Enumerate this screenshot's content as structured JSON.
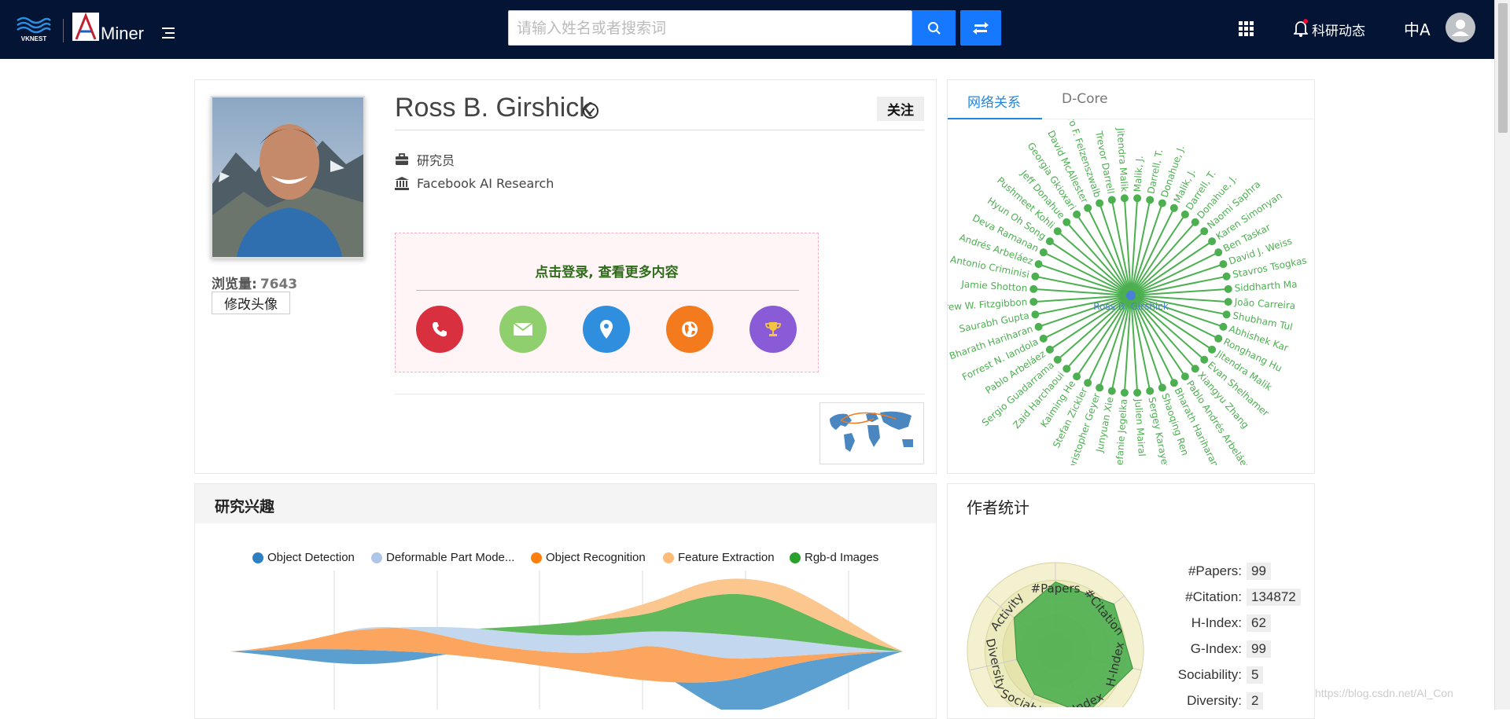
{
  "header": {
    "logo_left": "VKNEST",
    "logo_right": "Miner",
    "search_placeholder": "请输入姓名或者搜索词",
    "news": "科研动态",
    "lang": "中A"
  },
  "profile": {
    "name": "Ross B. Girshick",
    "follow": "关注",
    "position": "研究员",
    "affiliation": "Facebook AI Research",
    "views_label": "浏览量:",
    "views": "7643",
    "edit_avatar": "修改头像",
    "login_prompt": "点击登录, 查看更多内容",
    "contact_icons": [
      "phone-icon",
      "mail-icon",
      "location-icon",
      "homepage-icon",
      "trophy-icon"
    ],
    "contact_colors": [
      "#d9303f",
      "#8fcf6e",
      "#2f8fde",
      "#f37a1d",
      "#8a5bd6"
    ]
  },
  "network": {
    "tabs": [
      "网络关系",
      "D-Core"
    ],
    "center": "Ross B. Girshick",
    "nodes": [
      "Malik, J.",
      "Darrell, T.",
      "Donahue, J.",
      "Malik, J.",
      "Darrell, T.",
      "Donahue, J.",
      "Naomi Saphra",
      "Karen Simonyan",
      "Ben Taskar",
      "David J. Weiss",
      "Stavros Tsogkas",
      "Siddharth Ma",
      "João Carreira",
      "Shubham Tul",
      "Abhishek Kar",
      "Ronghang Hu",
      "Jitendra Malik",
      "Evan Shelhamer",
      "Xiangyu Zhang",
      "Pablo Andrés Arbeláez",
      "Bharath Hariharan",
      "Shaoqing Ren",
      "Sergey Karayev",
      "Julien Mairal",
      "Stefanie Jegelka",
      "Junyuan Xie",
      "Christopher Geyer",
      "Stefan Zickler",
      "Kaiming He",
      "Zaid Harchaoui",
      "Sergio Guadarrama",
      "Pablo Arbeláez",
      "Forrest N. Iandola",
      "Bharath Hariharan",
      "Saurabh Gupta",
      "Andrew W. Fitzgibbon",
      "Jamie Shotton",
      "Antonio Criminisi",
      "Andrés Arbeláez",
      "Deva Ramanan",
      "Hyun Oh Song",
      "Pushmeet Kohli",
      "Jeff Donahue",
      "Georgia Gkioxari",
      "David McAllester",
      "Pedro F. Felzenszwalb",
      "Trevor Darrell",
      "Jitendra Malik"
    ],
    "color": "#4caf50",
    "center_color": "#4a7fd8"
  },
  "interests": {
    "title": "研究兴趣",
    "legend": [
      {
        "label": "Object Detection",
        "color": "#2e7fc2"
      },
      {
        "label": "Deformable Part Mode...",
        "color": "#aec7e8"
      },
      {
        "label": "Object Recognition",
        "color": "#ff7f0e"
      },
      {
        "label": "Feature Extraction",
        "color": "#ffbb78"
      },
      {
        "label": "Rgb-d Images",
        "color": "#2ca02c"
      }
    ]
  },
  "stats": {
    "title": "作者统计",
    "axes": [
      "#Papers",
      "#Citation",
      "H-Index",
      "G-Index",
      "Sociability",
      "Diversity",
      "Activity"
    ],
    "items": [
      {
        "label": "#Papers:",
        "value": "99"
      },
      {
        "label": "#Citation:",
        "value": "134872"
      },
      {
        "label": "H-Index:",
        "value": "62"
      },
      {
        "label": "G-Index:",
        "value": "99"
      },
      {
        "label": "Sociability:",
        "value": "5"
      },
      {
        "label": "Diversity:",
        "value": "2"
      }
    ]
  },
  "watermark": "https://blog.csdn.net/AI_Con"
}
